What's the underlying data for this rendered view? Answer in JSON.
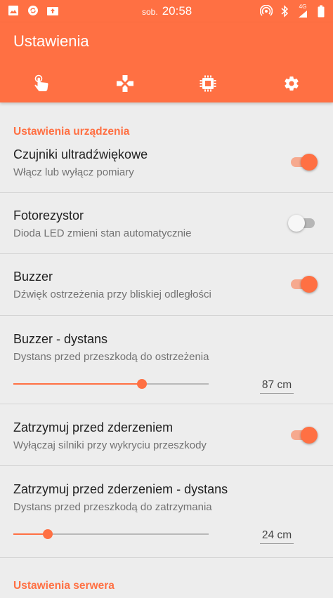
{
  "status_bar": {
    "day": "sob.",
    "time": "20:58",
    "network": "4G",
    "left_icons": [
      "image-icon",
      "sync-icon",
      "media-upload-icon"
    ],
    "right_icons": [
      "hotspot-icon",
      "bluetooth-icon",
      "signal-icon",
      "battery-icon"
    ]
  },
  "app_bar": {
    "title": "Ustawienia",
    "tabs": [
      {
        "icon": "touch-icon"
      },
      {
        "icon": "gamepad-icon"
      },
      {
        "icon": "chip-icon"
      },
      {
        "icon": "gear-icon",
        "selected": true
      }
    ]
  },
  "sections": {
    "device": {
      "header": "Ustawienia urządzenia",
      "ultrasonic": {
        "title": "Czujniki ultradźwiękowe",
        "summary": "Włącz lub wyłącz pomiary",
        "checked": true
      },
      "photoresistor": {
        "title": "Fotorezystor",
        "summary": "Dioda LED zmieni stan automatycznie",
        "checked": false
      },
      "buzzer": {
        "title": "Buzzer",
        "summary": "Dźwięk ostrzeżenia przy bliskiej odległości",
        "checked": true
      },
      "buzzer_distance": {
        "title": "Buzzer - dystans",
        "summary": "Dystans przed przeszkodą do ostrzeżenia",
        "value_label": "87 cm",
        "fraction": 0.66
      },
      "stop_before_collision": {
        "title": "Zatrzymuj przed zderzeniem",
        "summary": "Wyłączaj silniki przy wykryciu przeszkody",
        "checked": true
      },
      "stop_distance": {
        "title": "Zatrzymuj przed zderzeniem - dystans",
        "summary": "Dystans przed przeszkodą do zatrzymania",
        "value_label": "24 cm",
        "fraction": 0.175
      }
    },
    "server": {
      "header": "Ustawienia serwera"
    }
  },
  "colors": {
    "accent": "#ff7043",
    "background": "#ededed",
    "divider": "#d4d4d4"
  }
}
